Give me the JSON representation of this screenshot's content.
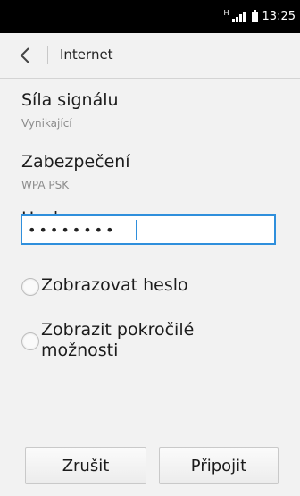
{
  "status_bar": {
    "network_type": "H",
    "time": "13:25"
  },
  "header": {
    "back_icon": "chevron-left-icon",
    "title": "Internet"
  },
  "signal_strength": {
    "label": "Síla signálu",
    "value": "Vynikající"
  },
  "security": {
    "label": "Zabezpečení",
    "value": "WPA PSK"
  },
  "password": {
    "label": "Heslo",
    "value": "••••••••"
  },
  "options": {
    "show_password": "Zobrazovat heslo",
    "advanced_line1": "Zobrazit pokročilé",
    "advanced_line2": "možnosti"
  },
  "buttons": {
    "cancel": "Zrušit",
    "connect": "Připojit"
  },
  "colors": {
    "accent": "#2f8fdc",
    "status_bar": "#000000",
    "background": "#f2f2f2"
  }
}
